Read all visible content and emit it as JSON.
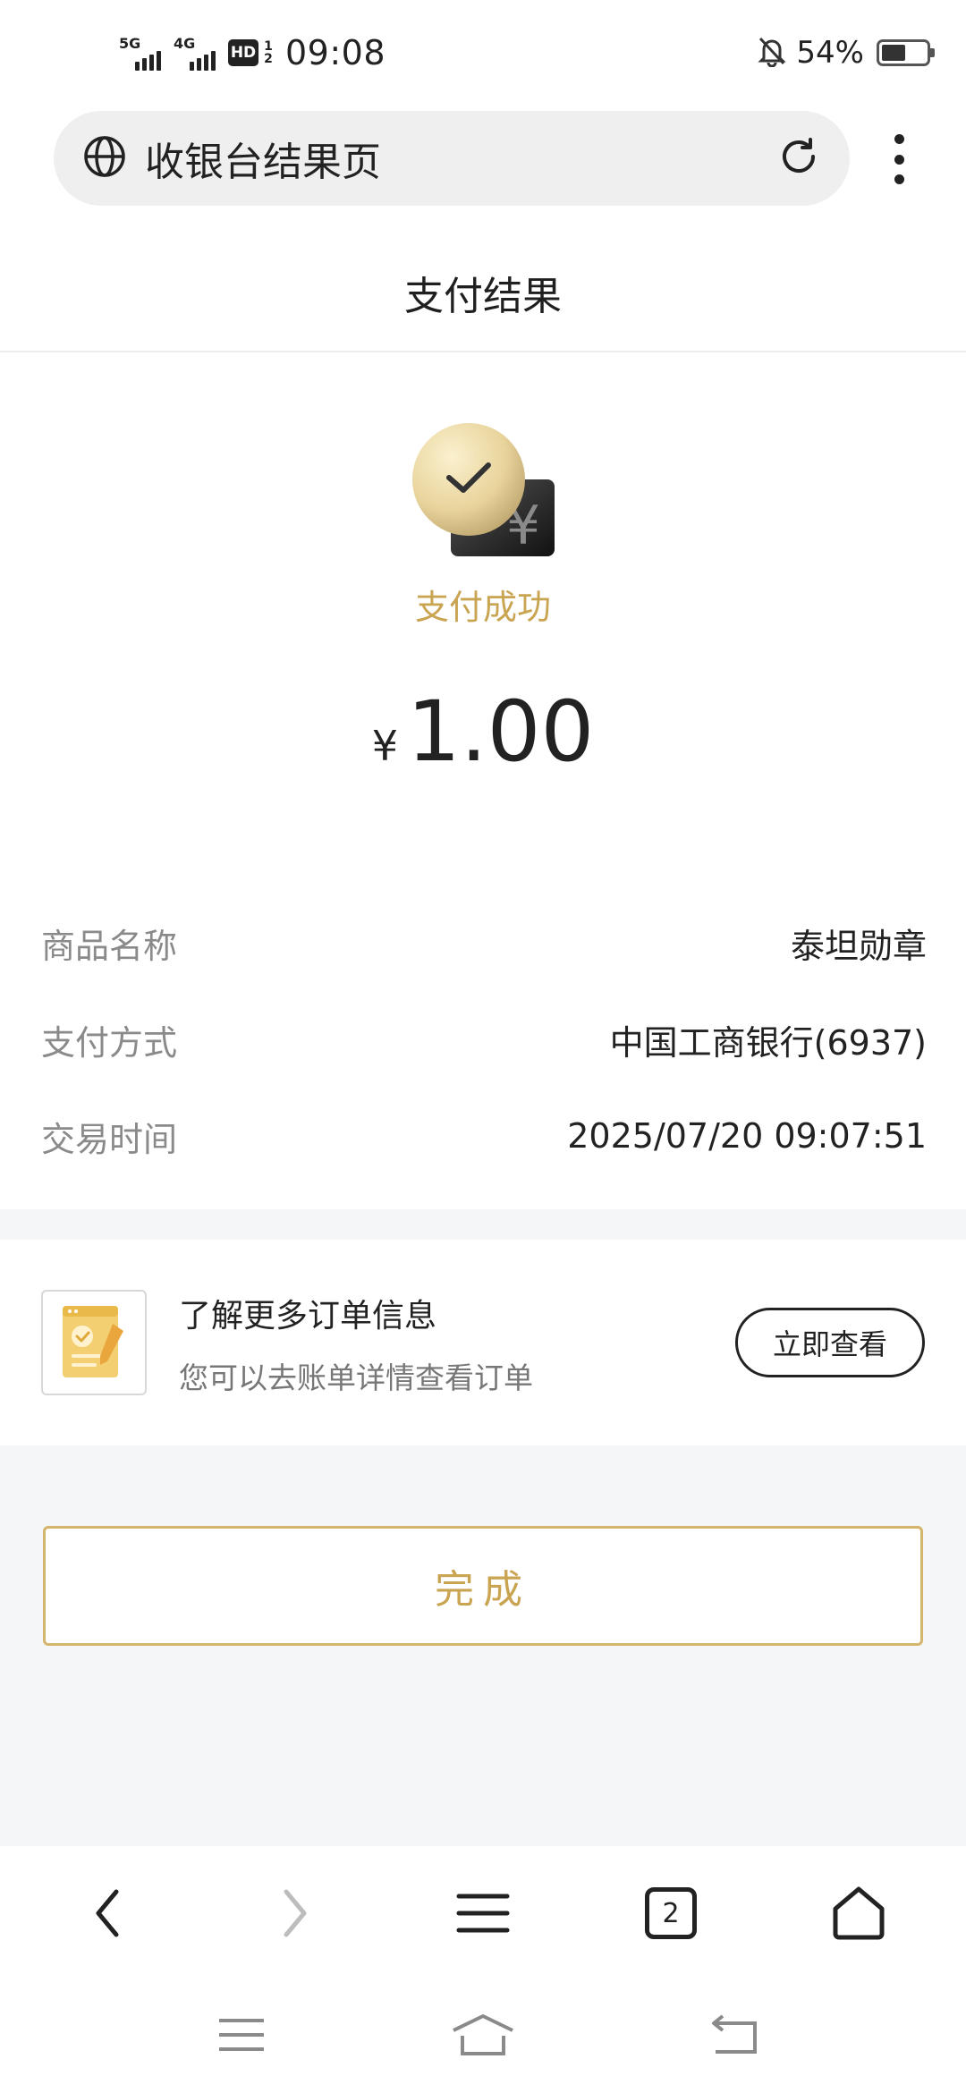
{
  "status_bar": {
    "network_1": "5G",
    "network_2": "4G",
    "hd": "HD",
    "hd_sub": "1 2",
    "time": "09:08",
    "battery_percent": "54%",
    "battery_level": 0.54
  },
  "browser": {
    "page_title": "收银台结果页",
    "icons": [
      "globe-icon",
      "refresh-icon",
      "more-vertical-icon"
    ]
  },
  "header": {
    "title": "支付结果"
  },
  "result": {
    "status_text": "支付成功",
    "currency_symbol": "¥",
    "amount": "1.00",
    "accent_color": "#c9a451"
  },
  "details": [
    {
      "label": "商品名称",
      "value": "泰坦勋章"
    },
    {
      "label": "支付方式",
      "value": "中国工商银行(6937)"
    },
    {
      "label": "交易时间",
      "value": "2025/07/20 09:07:51"
    }
  ],
  "order_card": {
    "title": "了解更多订单信息",
    "subtitle": "您可以去账单详情查看订单",
    "button_label": "立即查看"
  },
  "done_button": {
    "label": "完成"
  },
  "toolbar": {
    "tab_count": "2",
    "icons": [
      "back-icon",
      "forward-icon",
      "menu-icon",
      "tabs-icon",
      "home-icon"
    ]
  },
  "system_nav": {
    "icons": [
      "recents-icon",
      "home-nav-icon",
      "back-nav-icon"
    ]
  }
}
